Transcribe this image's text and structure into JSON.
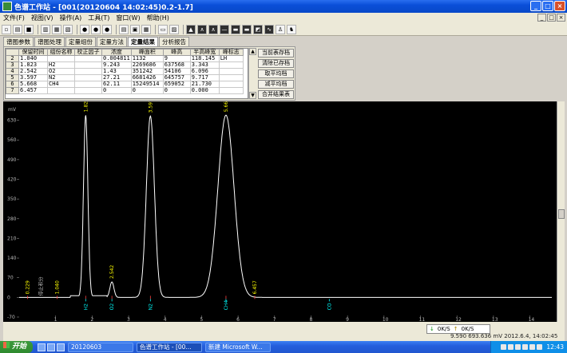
{
  "titlebar": {
    "title": "色谱工作站 - [001(20120604 14:02:45)0.2-1.7]"
  },
  "menu": [
    "文件(F)",
    "视图(V)",
    "操作(A)",
    "工具(T)",
    "窗口(W)",
    "帮助(H)"
  ],
  "tabs": [
    "谱图参数",
    "谱图处理",
    "定量组份",
    "定量方法",
    "定量结果",
    "分析报告"
  ],
  "active_tab": "定量结果",
  "table": {
    "headers": [
      "",
      "保留时间",
      "组份名称",
      "校正因子",
      "浓度",
      "峰面积",
      "峰高",
      "半高峰宽",
      "峰标志"
    ],
    "rows": [
      [
        "2",
        "1.040",
        "",
        "",
        "0.004811",
        "1132",
        "9",
        "118.145",
        "LH"
      ],
      [
        "3",
        "1.823",
        "H2",
        "",
        "9.243",
        "2269686",
        "637568",
        "3.343",
        ""
      ],
      [
        "4",
        "2.542",
        "O2",
        "",
        "1.43",
        "351242",
        "54106",
        "6.096",
        ""
      ],
      [
        "5",
        "3.597",
        "N2",
        "",
        "27.21",
        "6681426",
        "645757",
        "9.717",
        ""
      ],
      [
        "6",
        "5.668",
        "CH4",
        "",
        "62.11",
        "15249514",
        "659052",
        "21.730",
        ""
      ],
      [
        "7",
        "6.457",
        "",
        "",
        "0",
        "0",
        "0",
        "0.000",
        ""
      ]
    ]
  },
  "panel_buttons": [
    "当前表存档",
    "清除已存档",
    "取平均档",
    "减平均档",
    "合并结果表"
  ],
  "chart_data": {
    "type": "line",
    "ylabel": "mV",
    "yticks": [
      630,
      560,
      490,
      420,
      350,
      280,
      210,
      140,
      70,
      0,
      -70
    ],
    "xticks": [
      1,
      2,
      3,
      4,
      5,
      6,
      7,
      8,
      9,
      10,
      11,
      12,
      13,
      14
    ],
    "xlim": [
      0.0,
      14.6
    ],
    "ylim": [
      -70,
      680
    ],
    "peaks": [
      {
        "label": "1.823",
        "name": "H2",
        "rt": 1.823,
        "height": 648
      },
      {
        "label": "2.542",
        "name": "O2",
        "rt": 2.542,
        "height": 55
      },
      {
        "label": "3.597",
        "name": "N2",
        "rt": 3.597,
        "height": 645
      },
      {
        "label": "5.668",
        "name": "CH4",
        "rt": 5.668,
        "height": 648
      },
      {
        "label": "0.229",
        "name": "",
        "rt": 0.229,
        "height": 0
      },
      {
        "label": "1.040",
        "name": "",
        "rt": 1.04,
        "height": 0
      },
      {
        "label": "6.457",
        "name": "",
        "rt": 6.457,
        "height": 0
      }
    ],
    "marker_labels": [
      {
        "text": "H2",
        "rt": 1.823
      },
      {
        "text": "O2",
        "rt": 2.542
      },
      {
        "text": "N2",
        "rt": 3.597
      },
      {
        "text": "CH4",
        "rt": 5.668
      },
      {
        "text": "CO",
        "rt": 8.5
      }
    ],
    "annotation": "停止积分",
    "trace_color": "#ffffff",
    "label_color": "#ffff00",
    "marker_color": "#00ffff"
  },
  "speed": {
    "left": "0K/S",
    "right": "0K/S"
  },
  "status": "9.590    693.636 mV  2012.6.4, 14:02:45",
  "taskbar": {
    "start": "开始",
    "tasks": [
      "20120603",
      "色谱工作站 - [00...",
      "新建 Microsoft W..."
    ],
    "clock": "12:43"
  }
}
